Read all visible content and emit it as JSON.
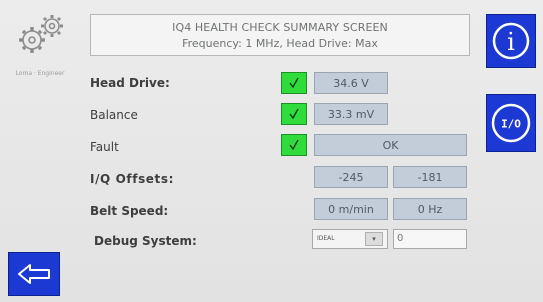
{
  "header": {
    "title": "IQ4 HEALTH CHECK SUMMARY SCREEN",
    "subtitle": "Frequency: 1 MHz, Head Drive: Max"
  },
  "logo": {
    "icon": "gears-icon",
    "caption": "Loma · Engineer"
  },
  "buttons": {
    "info": {
      "icon": "info-icon",
      "label": "i"
    },
    "io": {
      "icon": "io-icon",
      "label": "I/O"
    },
    "back": {
      "icon": "arrow-left-icon"
    }
  },
  "rows": {
    "head_drive": {
      "label": "Head Drive:",
      "checked": true,
      "value": "34.6 V"
    },
    "balance": {
      "label": "Balance",
      "checked": true,
      "value": "33.3 mV"
    },
    "fault": {
      "label": "Fault",
      "checked": true,
      "value": "OK"
    },
    "iq_offsets": {
      "label": "I/Q Offsets:",
      "values": [
        "-245",
        "-181"
      ]
    },
    "belt_speed": {
      "label": "Belt Speed:",
      "values": [
        "0 m/min",
        "0 Hz"
      ]
    },
    "debug": {
      "label": "Debug System:",
      "selected": "IDEAL",
      "input_value": "0"
    }
  },
  "colors": {
    "button_blue": "#1d39d4",
    "check_green": "#2fdc3c",
    "value_box": "#c3cdd9"
  }
}
